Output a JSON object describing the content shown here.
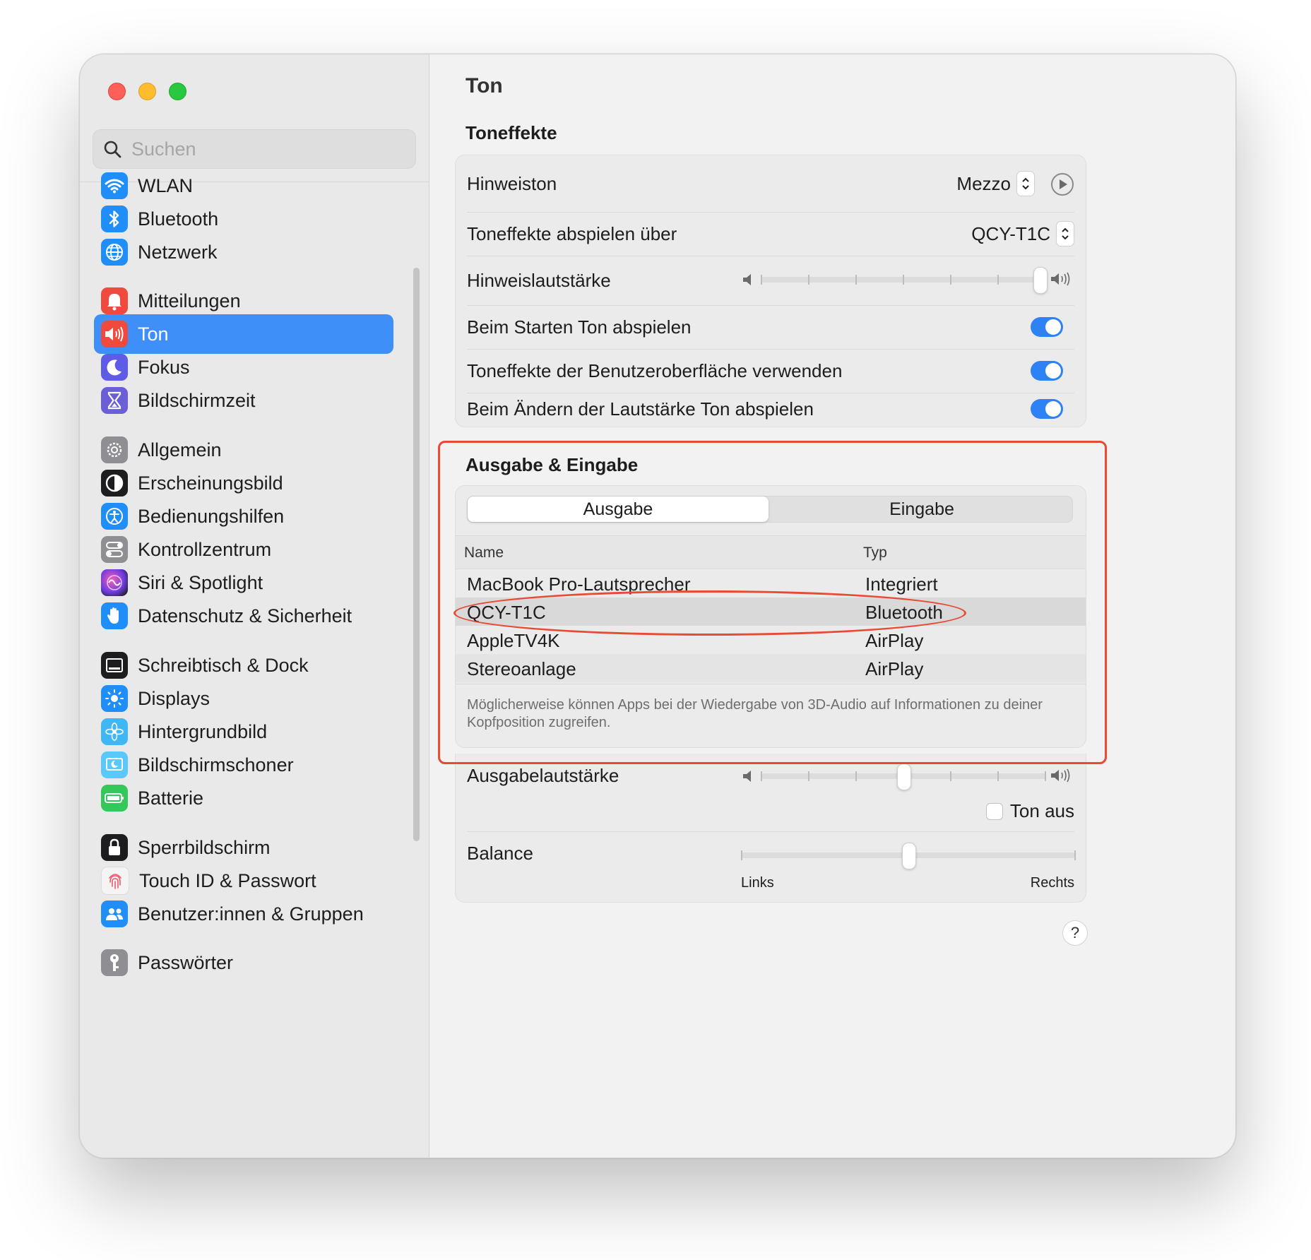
{
  "search": {
    "placeholder": "Suchen"
  },
  "sidebar": {
    "items": [
      {
        "label": "WLAN",
        "icon": "wifi-icon",
        "color": "#1f8ef9"
      },
      {
        "label": "Bluetooth",
        "icon": "bluetooth-icon",
        "color": "#1f8ef9"
      },
      {
        "label": "Netzwerk",
        "icon": "globe-icon",
        "color": "#1f8ef9"
      },
      {
        "label": "Mitteilungen",
        "icon": "bell-icon",
        "color": "#f0493e"
      },
      {
        "label": "Ton",
        "icon": "speaker-icon",
        "color": "#f0493e",
        "selected": true
      },
      {
        "label": "Fokus",
        "icon": "moon-icon",
        "color": "#5e5ce6"
      },
      {
        "label": "Bildschirmzeit",
        "icon": "hourglass-icon",
        "color": "#6a5fd7"
      },
      {
        "label": "Allgemein",
        "icon": "gear-icon",
        "color": "#8e8e93"
      },
      {
        "label": "Erscheinungsbild",
        "icon": "appearance-icon",
        "color": "#1d1d1f"
      },
      {
        "label": "Bedienungshilfen",
        "icon": "accessibility-icon",
        "color": "#1f8ef9"
      },
      {
        "label": "Kontrollzentrum",
        "icon": "toggles-icon",
        "color": "#8e8e93"
      },
      {
        "label": "Siri & Spotlight",
        "icon": "siri-icon",
        "color": "#7b3fe4"
      },
      {
        "label": "Datenschutz & Sicherheit",
        "icon": "hand-icon",
        "color": "#1f8ef9"
      },
      {
        "label": "Schreibtisch & Dock",
        "icon": "dock-icon",
        "color": "#1d1d1f"
      },
      {
        "label": "Displays",
        "icon": "sun-icon",
        "color": "#1f8ef9"
      },
      {
        "label": "Hintergrundbild",
        "icon": "flower-icon",
        "color": "#3fb7f5"
      },
      {
        "label": "Bildschirmschoner",
        "icon": "screensaver-icon",
        "color": "#5ac8fa"
      },
      {
        "label": "Batterie",
        "icon": "battery-icon",
        "color": "#34c759"
      },
      {
        "label": "Sperrbildschirm",
        "icon": "lock-icon",
        "color": "#1d1d1f"
      },
      {
        "label": "Touch ID & Passwort",
        "icon": "fingerprint-icon",
        "color": "#f4f4f4"
      },
      {
        "label": "Benutzer:innen & Gruppen",
        "icon": "users-icon",
        "color": "#1f8ef9"
      },
      {
        "label": "Passwörter",
        "icon": "key-icon",
        "color": "#8e8e93"
      }
    ]
  },
  "page": {
    "title": "Ton"
  },
  "toneffekte": {
    "title": "Toneffekte",
    "hinweiston": {
      "label": "Hinweiston",
      "value": "Mezzo"
    },
    "abspielen": {
      "label": "Toneffekte abspielen über",
      "value": "QCY-T1C"
    },
    "lautstaerke": {
      "label": "Hinweislautstärke",
      "level": 1.0
    },
    "toggles": [
      {
        "label": "Beim Starten Ton abspielen",
        "on": true
      },
      {
        "label": "Toneffekte der Benutzeroberfläche verwenden",
        "on": true
      },
      {
        "label": "Beim Ändern der Lautstärke Ton abspielen",
        "on": true
      }
    ]
  },
  "ausgabe": {
    "title": "Ausgabe & Eingabe",
    "tabs": [
      "Ausgabe",
      "Eingabe"
    ],
    "active_tab": "Ausgabe",
    "columns": [
      "Name",
      "Typ"
    ],
    "devices": [
      {
        "name": "MacBook Pro-Lautsprecher",
        "type": "Integriert"
      },
      {
        "name": "QCY-T1C",
        "type": "Bluetooth",
        "selected": true
      },
      {
        "name": "AppleTV4K",
        "type": "AirPlay"
      },
      {
        "name": "Stereoanlage",
        "type": "AirPlay"
      }
    ],
    "note": "Möglicherweise können Apps bei der Wiedergabe von 3D-Audio auf Informationen zu deiner Kopfposition zugreifen."
  },
  "output": {
    "volume_label": "Ausgabelautstärke",
    "volume_level": 0.5,
    "mute_label": "Ton aus",
    "muted": false,
    "balance_label": "Balance",
    "balance_level": 0.5,
    "balance_left": "Links",
    "balance_right": "Rechts"
  },
  "help": "?",
  "annotation_color": "#e84a33"
}
